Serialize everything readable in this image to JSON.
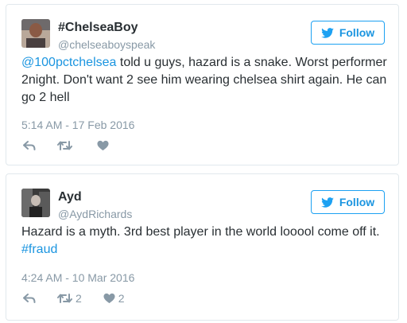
{
  "tweets": [
    {
      "name": "#ChelseaBoy",
      "handle": "@chelseaboyspeak",
      "follow_label": "Follow",
      "text_mention": "@100pctchelsea",
      "text_body": " told u guys, hazard is a snake. Worst performer 2night. Don't want 2 see him wearing chelsea shirt again. He can go 2 hell",
      "timestamp": "5:14 AM - 17 Feb 2016",
      "retweets": "",
      "likes": ""
    },
    {
      "name": "Ayd",
      "handle": "@AydRichards",
      "follow_label": "Follow",
      "text_body": "Hazard is a myth. 3rd best player in the world looool come off it. ",
      "text_hashtag": "#fraud",
      "timestamp": "4:24 AM - 10 Mar 2016",
      "retweets": "2",
      "likes": "2"
    }
  ],
  "colors": {
    "accent": "#1b95e0",
    "muted": "#8899a6",
    "border": "#e1e8ed",
    "text": "#292f33"
  },
  "icons": [
    "twitter-bird-icon",
    "reply-icon",
    "retweet-icon",
    "heart-icon"
  ]
}
